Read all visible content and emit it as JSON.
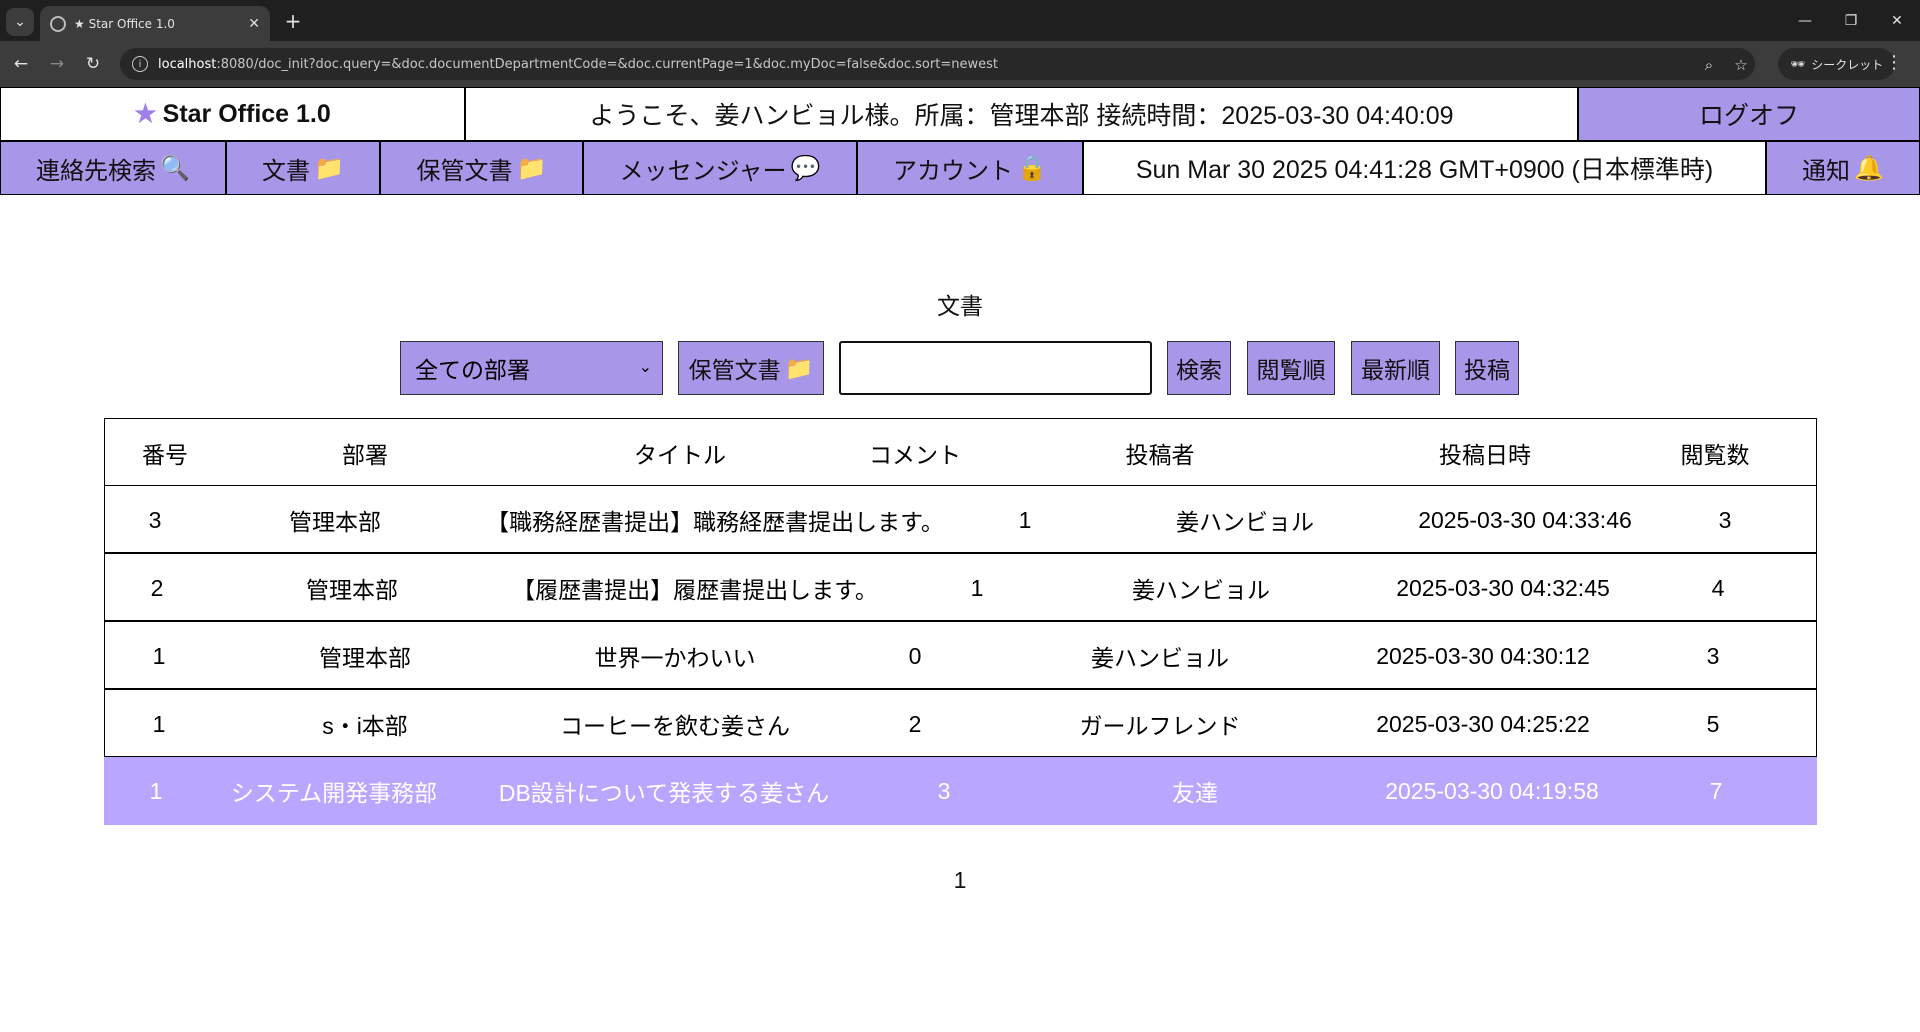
{
  "browser": {
    "tab_title": "★ Star Office 1.0",
    "url_host": "localhost",
    "url_rest": ":8080/doc_init?doc.query=&doc.documentDepartmentCode=&doc.currentPage=1&doc.myDoc=false&doc.sort=newest",
    "incognito_label": "シークレット"
  },
  "header": {
    "brand": "Star Office 1.0",
    "welcome": "ようこそ、姜ハンビョル様。所属：管理本部 接続時間：2025-03-30 04:40:09",
    "logoff": "ログオフ"
  },
  "nav": {
    "contacts": "連絡先検索",
    "documents": "文書",
    "archived": "保管文書",
    "messenger": "メッセンジャー",
    "account": "アカウント",
    "clock": "Sun Mar 30 2025 04:41:28 GMT+0900 (日本標準時)",
    "notify": "通知"
  },
  "main": {
    "title": "文書",
    "department_select": "全ての部署",
    "archived_button": "保管文書",
    "search_value": "",
    "search_button": "検索",
    "sort_views": "閲覧順",
    "sort_newest": "最新順",
    "post_button": "投稿"
  },
  "table": {
    "headers": [
      "番号",
      "部署",
      "タイトル",
      "コメント",
      "投稿者",
      "投稿日時",
      "閲覧数"
    ],
    "rows": [
      [
        "3",
        "管理本部",
        "【職務経歴書提出】職務経歴書提出します。",
        "1",
        "姜ハンビョル",
        "2025-03-30 04:33:46",
        "3"
      ],
      [
        "2",
        "管理本部",
        "【履歴書提出】履歴書提出します。",
        "1",
        "姜ハンビョル",
        "2025-03-30 04:32:45",
        "4"
      ],
      [
        "1",
        "管理本部",
        "世界一かわいい",
        "0",
        "姜ハンビョル",
        "2025-03-30 04:30:12",
        "3"
      ],
      [
        "1",
        "s・i本部",
        "コーヒーを飲む姜さん",
        "2",
        "ガールフレンド",
        "2025-03-30 04:25:22",
        "5"
      ],
      [
        "1",
        "システム開発事務部",
        "DB設計について発表する姜さん",
        "3",
        "友達",
        "2025-03-30 04:19:58",
        "7"
      ]
    ]
  },
  "pagination": {
    "current": "1"
  },
  "colors": {
    "accent": "#a896e8",
    "highlight_row": "#b9a7ff"
  }
}
